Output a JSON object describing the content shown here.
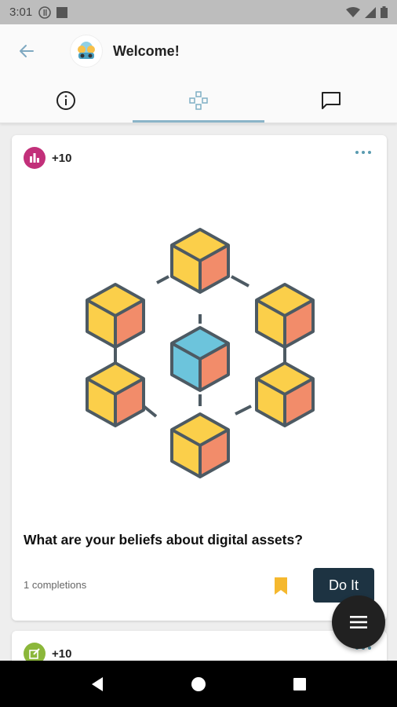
{
  "status_bar": {
    "time": "3:01"
  },
  "header": {
    "title": "Welcome!"
  },
  "tabs": [
    {
      "name": "info",
      "icon": "info-icon"
    },
    {
      "name": "activities",
      "icon": "gamepad-icon",
      "active": true
    },
    {
      "name": "chat",
      "icon": "chat-icon"
    }
  ],
  "cards": [
    {
      "badge_color": "#c2307a",
      "badge_icon": "bar-chart-icon",
      "points": "+10",
      "question": "What are your beliefs about digital assets?",
      "completions": "1 completions",
      "action_label": "Do It"
    },
    {
      "badge_color": "#8bb73a",
      "badge_icon": "edit-icon",
      "points": "+10"
    }
  ],
  "colors": {
    "accent": "#8ab4c8",
    "button": "#1d3342",
    "bookmark": "#f5b82e"
  }
}
